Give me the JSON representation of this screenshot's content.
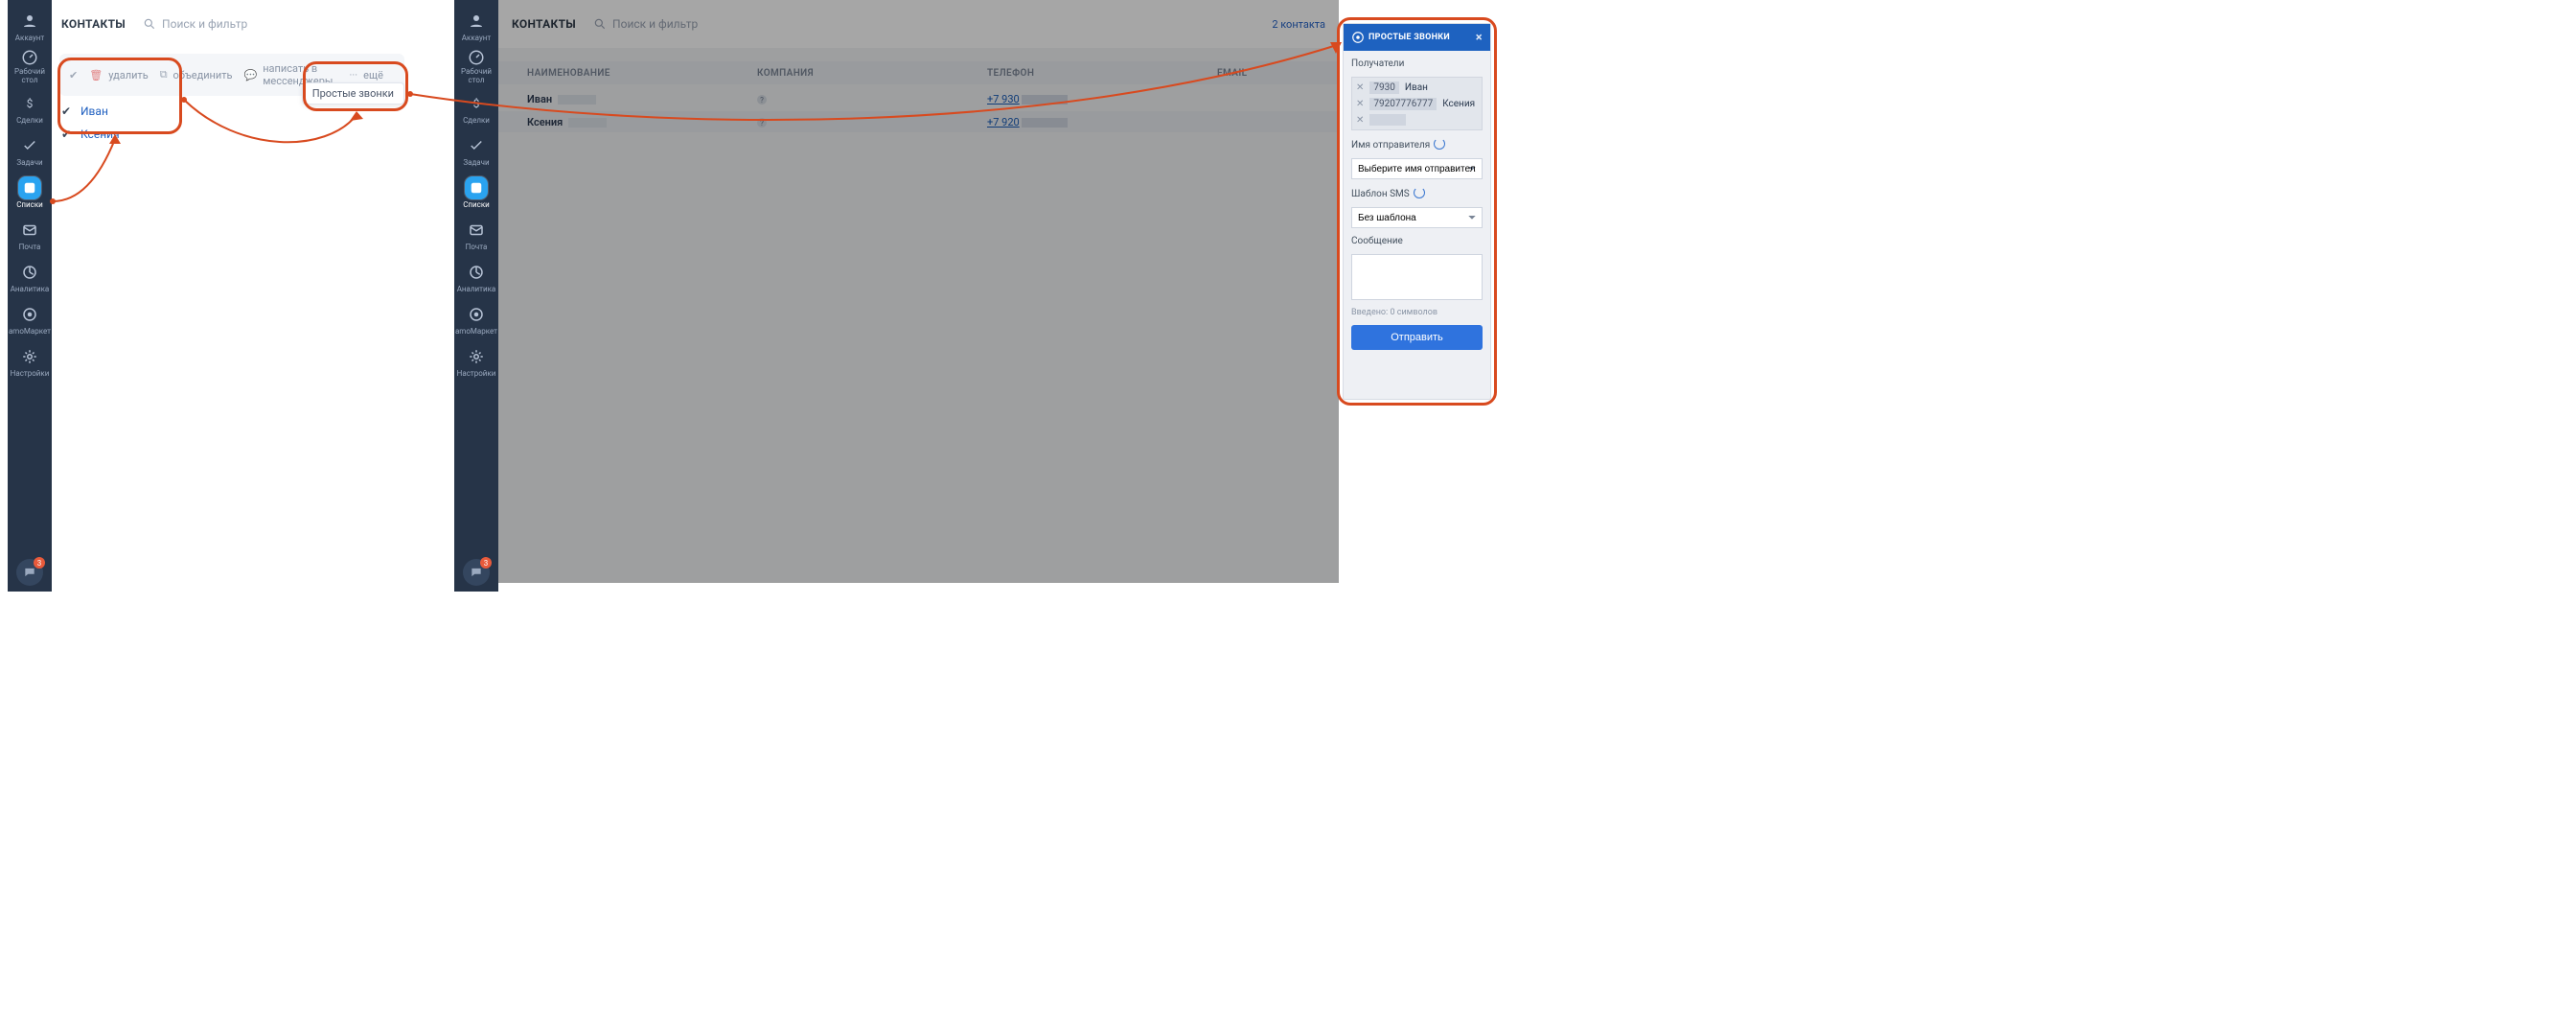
{
  "sidebar": {
    "items": [
      {
        "label": "Аккаунт"
      },
      {
        "label_line1": "Рабочий",
        "label_line2": "стол"
      },
      {
        "label": "Сделки"
      },
      {
        "label": "Задачи"
      },
      {
        "label": "Списки"
      },
      {
        "label": "Почта"
      },
      {
        "label": "Аналитика"
      },
      {
        "label": "amoМаркет"
      },
      {
        "label": "Настройки"
      }
    ],
    "chat_badge": "3"
  },
  "panelA": {
    "title": "КОНТАКТЫ",
    "search_placeholder": "Поиск и фильтр",
    "toolbar": {
      "delete": "удалить",
      "merge": "объединить",
      "message": "написать в мессенджеры",
      "more": "ещё",
      "dropdown": "Простые звонки"
    },
    "contacts": [
      "Иван",
      "Ксения"
    ]
  },
  "panelB": {
    "title": "КОНТАКТЫ",
    "search_placeholder": "Поиск и фильтр",
    "count_note": "2 контакта",
    "columns": {
      "name": "НАИМЕНОВАНИЕ",
      "company": "КОМПАНИЯ",
      "phone": "ТЕЛЕФОН",
      "email": "EMAIL"
    },
    "rows": [
      {
        "name": "Иван",
        "phone": "+7 930"
      },
      {
        "name": "Ксения",
        "phone": "+7 920"
      }
    ]
  },
  "modal": {
    "brand": "ПРОСТЫЕ ЗВОНКИ",
    "recipients_label": "Получатели",
    "recipients": [
      {
        "number": "7930",
        "name": "Иван"
      },
      {
        "number": "79207776777",
        "name": "Ксения"
      }
    ],
    "sender_label": "Имя отправителя",
    "sender_placeholder": "Выберите имя отправителя",
    "template_label": "Шаблон SMS",
    "template_placeholder": "Без шаблона",
    "message_label": "Сообщение",
    "chars_hint": "Введено: 0 символов",
    "send": "Отправить"
  }
}
